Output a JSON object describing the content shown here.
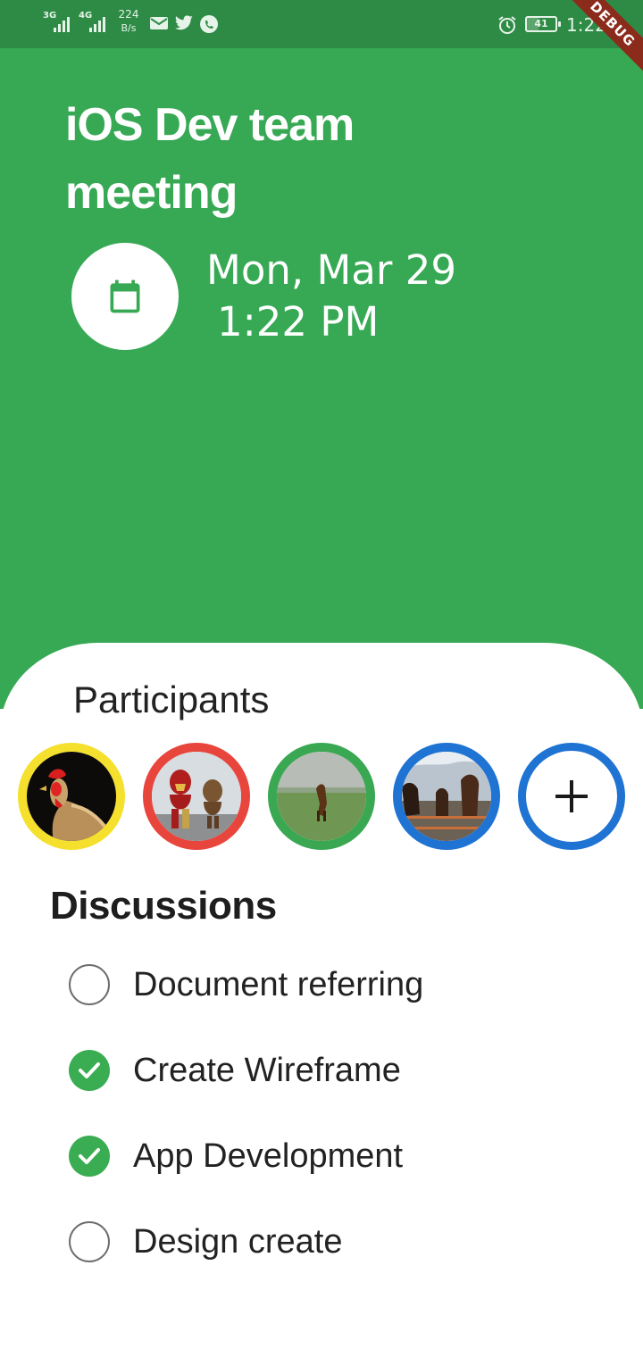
{
  "status_bar": {
    "network_1": "3G",
    "network_2": "4G",
    "speed_value": "224",
    "speed_unit": "B/s",
    "notification_icons": [
      "mail-icon",
      "twitter-icon",
      "whatsapp-icon"
    ],
    "alarm_icon": "alarm-icon",
    "battery_level": "41",
    "time": "1:22"
  },
  "debug_banner": {
    "label": "DEBUG",
    "color": "#8b2b1c"
  },
  "header": {
    "title": "iOS Dev team meeting",
    "date": "Mon, Mar 29",
    "time": "1:22 PM",
    "calendar_icon": "calendar-icon",
    "background_color": "#37a954"
  },
  "participants": {
    "title": "Participants",
    "avatars": [
      {
        "name": "avatar-rooster",
        "border_color": "#f5e02e"
      },
      {
        "name": "avatar-ironman-groot",
        "border_color": "#e8453c"
      },
      {
        "name": "avatar-horse-field",
        "border_color": "#3aa853"
      },
      {
        "name": "avatar-horses-fence",
        "border_color": "#1f73d2"
      }
    ],
    "add_icon": "plus-icon",
    "add_color": "#1f73d2"
  },
  "discussions": {
    "title": "Discussions",
    "items": [
      {
        "label": "Document referring",
        "checked": false
      },
      {
        "label": "Create Wireframe",
        "checked": true
      },
      {
        "label": "App Development",
        "checked": true
      },
      {
        "label": "Design create",
        "checked": false
      }
    ],
    "check_color": "#3aad52"
  }
}
